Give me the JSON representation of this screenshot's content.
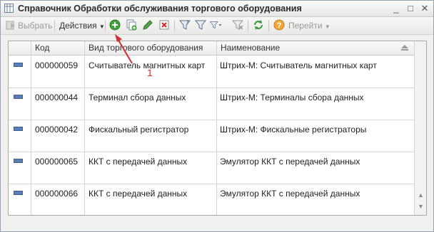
{
  "window": {
    "title": "Справочник Обработки обслуживания торгового оборудования",
    "controls": [
      "_",
      "□",
      "✕"
    ]
  },
  "toolbar": {
    "select_label": "Выбрать",
    "actions_label": "Действия",
    "goto_label": "Перейти",
    "icons": [
      "add-icon",
      "copy-icon",
      "edit-icon",
      "delete-icon",
      "hierarchy-filter-icon",
      "filter-icon",
      "filter-dropdown-icon",
      "clear-filter-icon",
      "refresh-icon",
      "help-icon"
    ]
  },
  "table": {
    "columns": [
      "Код",
      "Вид торгового оборудования",
      "Наименование"
    ],
    "rows": [
      {
        "code": "000000059",
        "type": "Считыватель магнитных карт",
        "name": "Штрих-М: Считыватель магнитных карт"
      },
      {
        "code": "000000044",
        "type": "Терминал сбора данных",
        "name": "Штрих-М: Терминалы сбора данных"
      },
      {
        "code": "000000042",
        "type": "Фискальный регистратор",
        "name": "Штрих-М: Фискальные регистраторы"
      },
      {
        "code": "000000065",
        "type": "ККТ с передачей данных",
        "name": "Эмулятор ККТ с передачей данных"
      },
      {
        "code": "000000066",
        "type": "ККТ с передачей данных",
        "name": "Эмулятор ККТ с передачей данных"
      }
    ]
  },
  "annotation": {
    "number": "1",
    "color": "#d03030"
  }
}
